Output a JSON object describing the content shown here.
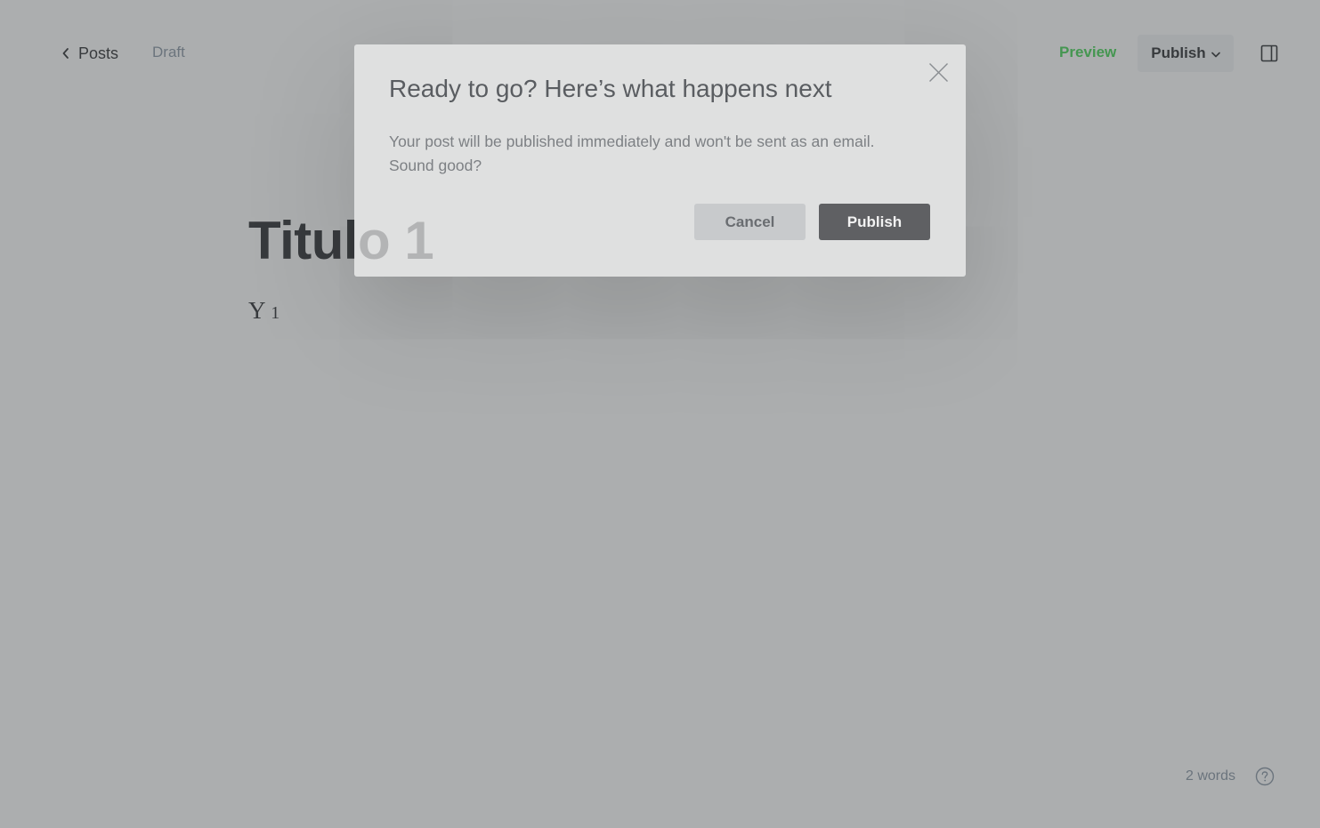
{
  "header": {
    "back_label": "Posts",
    "status": "Draft",
    "preview_label": "Preview",
    "publish_label": "Publish"
  },
  "editor": {
    "title": "Titulo 1",
    "body_text": "Y",
    "body_sub": "1"
  },
  "footer": {
    "word_count": "2 words"
  },
  "modal": {
    "title": "Ready to go? Here’s what happens next",
    "line1": "Your post will be published immediately and won't be sent as an email.",
    "line2": "Sound good?",
    "cancel_label": "Cancel",
    "confirm_label": "Publish"
  },
  "colors": {
    "accent_green": "#30cf43",
    "text_dark": "#15171a",
    "muted": "#7c8b9a",
    "confirm_button": "#5f6063"
  }
}
